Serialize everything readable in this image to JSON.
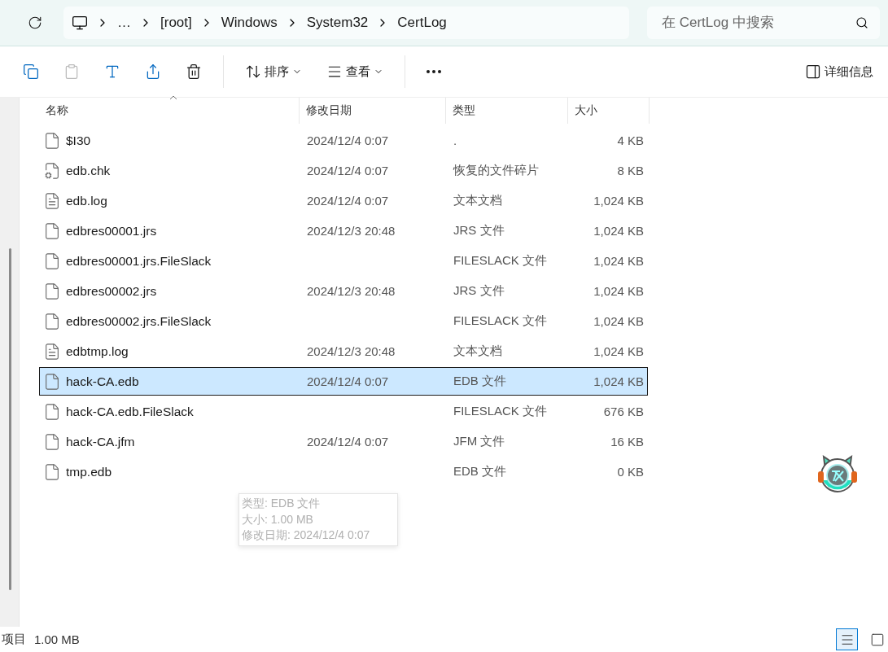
{
  "address_bar": {
    "crumbs": [
      "…",
      "[root]",
      "Windows",
      "System32",
      "CertLog"
    ]
  },
  "search": {
    "placeholder": "在 CertLog 中搜索"
  },
  "toolbar": {
    "sort_label": "排序",
    "view_label": "查看",
    "details_label": "详细信息"
  },
  "table": {
    "columns": [
      "名称",
      "修改日期",
      "类型",
      "大小"
    ],
    "rows": [
      {
        "name": "$I30",
        "date": "2024/12/4 0:07",
        "type": ".",
        "size": "4 KB",
        "kind": "blank",
        "selected": false
      },
      {
        "name": "edb.chk",
        "date": "2024/12/4 0:07",
        "type": "恢复的文件碎片",
        "size": "8 KB",
        "kind": "system",
        "selected": false
      },
      {
        "name": "edb.log",
        "date": "2024/12/4 0:07",
        "type": "文本文档",
        "size": "1,024 KB",
        "kind": "text",
        "selected": false
      },
      {
        "name": "edbres00001.jrs",
        "date": "2024/12/3 20:48",
        "type": "JRS 文件",
        "size": "1,024 KB",
        "kind": "blank",
        "selected": false
      },
      {
        "name": "edbres00001.jrs.FileSlack",
        "date": "",
        "type": "FILESLACK 文件",
        "size": "1,024 KB",
        "kind": "blank",
        "selected": false
      },
      {
        "name": "edbres00002.jrs",
        "date": "2024/12/3 20:48",
        "type": "JRS 文件",
        "size": "1,024 KB",
        "kind": "blank",
        "selected": false
      },
      {
        "name": "edbres00002.jrs.FileSlack",
        "date": "",
        "type": "FILESLACK 文件",
        "size": "1,024 KB",
        "kind": "blank",
        "selected": false
      },
      {
        "name": "edbtmp.log",
        "date": "2024/12/3 20:48",
        "type": "文本文档",
        "size": "1,024 KB",
        "kind": "text",
        "selected": false
      },
      {
        "name": "hack-CA.edb",
        "date": "2024/12/4 0:07",
        "type": "EDB 文件",
        "size": "1,024 KB",
        "kind": "blank",
        "selected": true
      },
      {
        "name": "hack-CA.edb.FileSlack",
        "date": "",
        "type": "FILESLACK 文件",
        "size": "676 KB",
        "kind": "blank",
        "selected": false
      },
      {
        "name": "hack-CA.jfm",
        "date": "2024/12/4 0:07",
        "type": "JFM 文件",
        "size": "16 KB",
        "kind": "blank",
        "selected": false
      },
      {
        "name": "tmp.edb",
        "date": "",
        "type": "EDB 文件",
        "size": "0 KB",
        "kind": "blank",
        "selected": false
      }
    ]
  },
  "tooltip": {
    "lines": [
      "类型: EDB 文件",
      "大小: 1.00 MB",
      "修改日期: 2024/12/4 0:07"
    ]
  },
  "status_bar": {
    "items_label": "项目",
    "selection_size": "1.00 MB",
    "views": [
      {
        "kind": "details",
        "selected": true
      },
      {
        "kind": "tiles",
        "selected": false
      }
    ]
  }
}
